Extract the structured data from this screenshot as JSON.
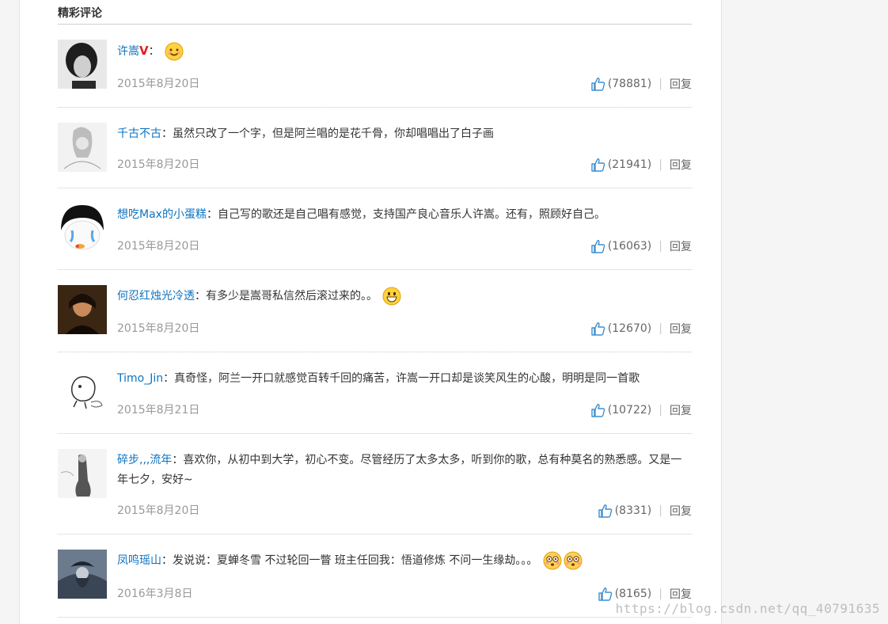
{
  "section": {
    "title": "精彩评论"
  },
  "comments": [
    {
      "user": "许嵩",
      "vip": "V",
      "sep": "：",
      "text": "",
      "date": "2015年8月20日",
      "likes": "(78881)",
      "reply": "回复"
    },
    {
      "user": "千古不古",
      "sep": "：",
      "text": "虽然只改了一个字，但是阿兰唱的是花千骨，你却唱唱出了白子画",
      "date": "2015年8月20日",
      "likes": "(21941)",
      "reply": "回复"
    },
    {
      "user": "想吃Max的小蛋糕",
      "sep": "：",
      "text": "自己写的歌还是自己唱有感觉，支持国产良心音乐人许嵩。还有，照顾好自己。",
      "date": "2015年8月20日",
      "likes": "(16063)",
      "reply": "回复"
    },
    {
      "user": "何忍红烛光冷透",
      "sep": "：",
      "text": "有多少是嵩哥私信然后滚过来的。。",
      "date": "2015年8月20日",
      "likes": "(12670)",
      "reply": "回复"
    },
    {
      "user": "Timo_Jin",
      "sep": "：",
      "text": "真奇怪，阿兰一开口就感觉百转千回的痛苦，许嵩一开口却是谈笑风生的心酸，明明是同一首歌",
      "date": "2015年8月21日",
      "likes": "(10722)",
      "reply": "回复"
    },
    {
      "user": "碎步,,,流年",
      "sep": "：",
      "text": "喜欢你，从初中到大学，初心不变。尽管经历了太多太多，听到你的歌，总有种莫名的熟悉感。又是一年七夕，安好~",
      "date": "2015年8月20日",
      "likes": "(8331)",
      "reply": "回复"
    },
    {
      "user": "凤鸣瑶山",
      "sep": "：",
      "text": "发说说：夏蝉冬雪 不过轮回一瞥 班主任回我：悟道修炼 不问一生缘劫。。。",
      "date": "2016年3月8日",
      "likes": "(8165)",
      "reply": "回复"
    }
  ],
  "watermark": "https://blog.csdn.net/qq_40791635"
}
